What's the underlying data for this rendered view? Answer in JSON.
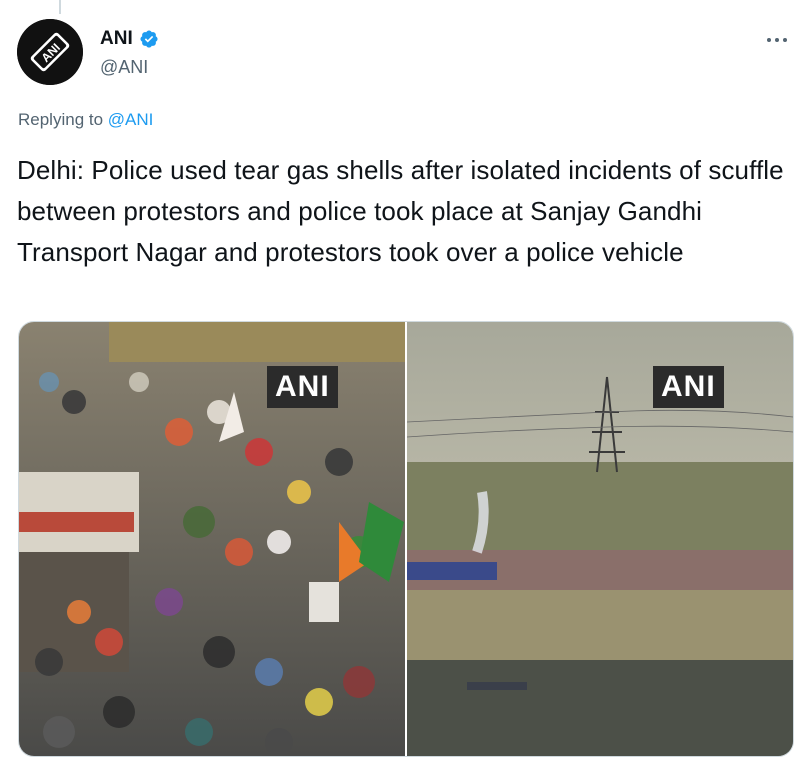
{
  "author": {
    "name": "ANI",
    "handle": "@ANI",
    "avatar_text": "ANI",
    "verified_icon": "verified-badge-icon",
    "verified_color": "#1d9bf0"
  },
  "reply": {
    "prefix": "Replying to",
    "to": "@ANI"
  },
  "tweet": {
    "text": "Delhi: Police used tear gas shells after isolated incidents of scuffle between protestors and police took place at Sanjay Gandhi Transport Nagar and protestors took over a police vehicle"
  },
  "media": {
    "left_watermark": "ANI",
    "right_watermark": "ANI"
  },
  "colors": {
    "text": "#0f1419",
    "secondary": "#536471",
    "link": "#1d9bf0"
  }
}
